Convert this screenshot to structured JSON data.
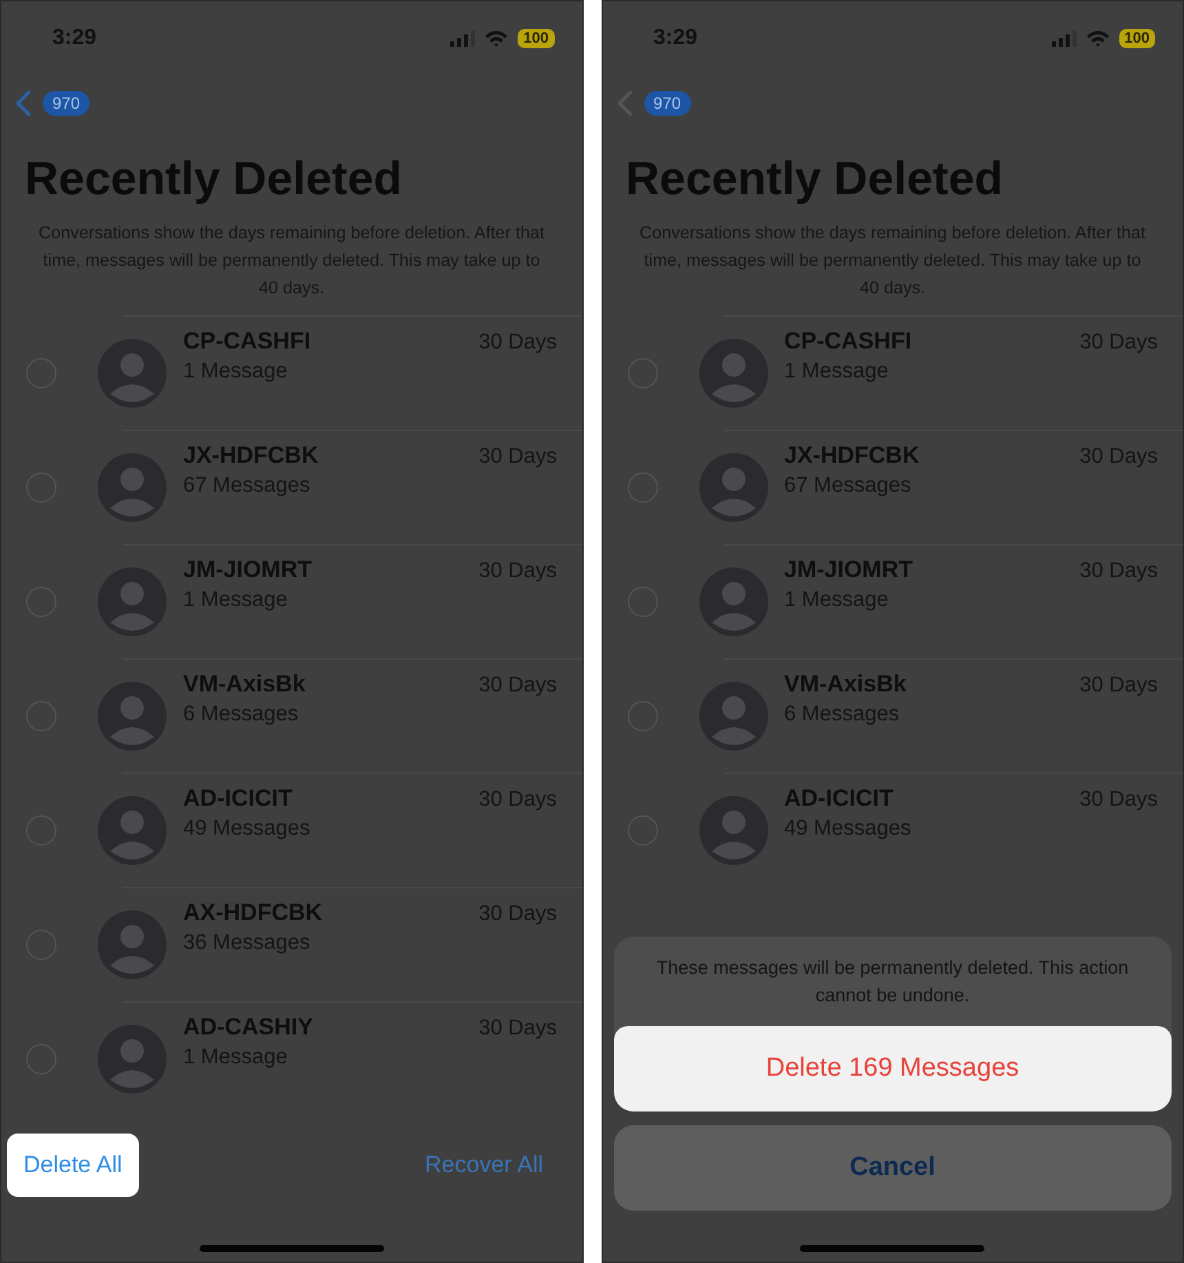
{
  "screens": [
    {
      "status_bar": {
        "time": "3:29",
        "battery": "100"
      },
      "nav": {
        "badge": "970"
      },
      "title": "Recently Deleted",
      "note": "Conversations show the days remaining before deletion. After that time, messages will be permanently deleted. This may take up to 40 days.",
      "conversations": [
        {
          "name": "CP-CASHFI",
          "count": "1 Message",
          "days": "30 Days",
          "selected": false
        },
        {
          "name": "JX-HDFCBK",
          "count": "67 Messages",
          "days": "30 Days",
          "selected": false
        },
        {
          "name": "JM-JIOMRT",
          "count": "1 Message",
          "days": "30 Days",
          "selected": false
        },
        {
          "name": "VM-AxisBk",
          "count": "6 Messages",
          "days": "30 Days",
          "selected": false
        },
        {
          "name": "AD-ICICIT",
          "count": "49 Messages",
          "days": "30 Days",
          "selected": false
        },
        {
          "name": "AX-HDFCBK",
          "count": "36 Messages",
          "days": "30 Days",
          "selected": false
        },
        {
          "name": "AD-CASHIY",
          "count": "1 Message",
          "days": "30 Days",
          "selected": false
        }
      ],
      "toolbar": {
        "buttons": [
          {
            "label": "Delete All",
            "highlighted": true
          },
          {
            "label": "Recover All",
            "highlighted": false
          }
        ]
      }
    },
    {
      "status_bar": {
        "time": "3:29",
        "battery": "100"
      },
      "nav": {
        "badge": "970"
      },
      "title": "Recently Deleted",
      "note": "Conversations show the days remaining before deletion. After that time, messages will be permanently deleted. This may take up to 40 days.",
      "conversations": [
        {
          "name": "CP-CASHFI",
          "count": "1 Message",
          "days": "30 Days",
          "selected": false
        },
        {
          "name": "JX-HDFCBK",
          "count": "67 Messages",
          "days": "30 Days",
          "selected": false
        },
        {
          "name": "JM-JIOMRT",
          "count": "1 Message",
          "days": "30 Days",
          "selected": false
        },
        {
          "name": "VM-AxisBk",
          "count": "6 Messages",
          "days": "30 Days",
          "selected": false
        },
        {
          "name": "AD-ICICIT",
          "count": "49 Messages",
          "days": "30 Days",
          "selected": false
        }
      ],
      "action_sheet": {
        "message": "These messages will be permanently deleted. This action cannot be undone.",
        "buttons": [
          {
            "label": "Delete 169 Messages",
            "kind": "destructive",
            "highlighted": true
          },
          {
            "label": "Cancel",
            "kind": "cancel",
            "highlighted": false
          }
        ]
      }
    }
  ]
}
